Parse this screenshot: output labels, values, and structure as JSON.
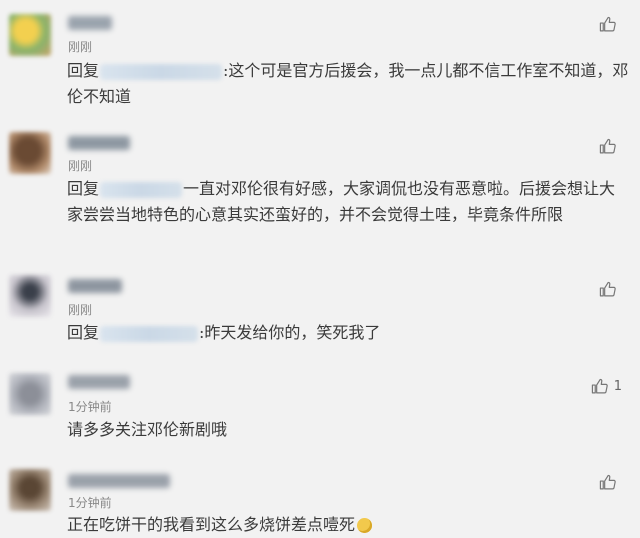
{
  "comments": [
    {
      "time": "刚刚",
      "reply_prefix": "回复",
      "text": ":这个可是官方后援会，我一点儿都不信工作室不知道，邓伦不知道",
      "likes": ""
    },
    {
      "time": "刚刚",
      "reply_prefix": "回复",
      "text": "一直对邓伦很有好感，大家调侃也没有恶意啦。后援会想让大家尝尝当地特色的心意其实还蛮好的，并不会觉得土哇，毕竟条件所限",
      "likes": ""
    },
    {
      "time": "刚刚",
      "reply_prefix": "回复",
      "text": ":昨天发给你的，笑死我了",
      "likes": ""
    },
    {
      "time": "1分钟前",
      "reply_prefix": "",
      "text": "请多多关注邓伦新剧哦",
      "likes": "1"
    },
    {
      "time": "1分钟前",
      "reply_prefix": "",
      "text": "正在吃饼干的我看到这么多烧饼差点噎死",
      "likes": ""
    }
  ],
  "icons": {
    "like": "thumbs-up-icon",
    "emoji": "tear-laugh-emoji-icon"
  },
  "colors": {
    "background": "#f2f2f2",
    "divider": "#dcdcdc",
    "text": "#3a3a3a",
    "time": "#888888"
  }
}
